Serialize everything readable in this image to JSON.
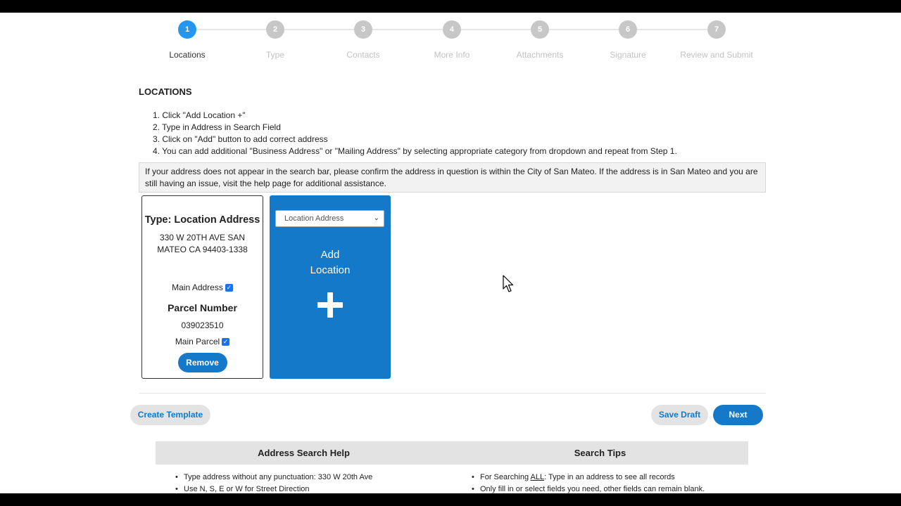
{
  "stepper": {
    "steps": [
      {
        "num": "1",
        "label": "Locations",
        "active": true
      },
      {
        "num": "2",
        "label": "Type"
      },
      {
        "num": "3",
        "label": "Contacts"
      },
      {
        "num": "4",
        "label": "More Info"
      },
      {
        "num": "5",
        "label": "Attachments"
      },
      {
        "num": "6",
        "label": "Signature"
      },
      {
        "num": "7",
        "label": "Review and Submit"
      }
    ]
  },
  "section": {
    "title": "LOCATIONS",
    "instructions": [
      "1. Click \"Add Location +\"",
      "2. Type in Address in Search Field",
      "3. Click on \"Add\" button to add correct address",
      "4. You can add additional \"Business Address\" or \"Mailing Address\" by selecting appropriate category from dropdown and repeat from Step 1."
    ],
    "notice": "If your address does not appear in the search bar, please confirm the address in question is within the City of San Mateo. If the address is in San Mateo and you are still having an issue, visit the help page for additional assistance."
  },
  "location_card": {
    "type_label": "Type: Location Address",
    "address": "330 W 20TH AVE SAN MATEO CA 94403-1338",
    "main_address_label": "Main Address",
    "parcel_title": "Parcel Number",
    "parcel_number": "039023510",
    "main_parcel_label": "Main Parcel",
    "remove_label": "Remove",
    "checkmark": "✓"
  },
  "add_card": {
    "select_value": "Location Address",
    "chevron": "⌄",
    "label_line1": "Add",
    "label_line2": "Location"
  },
  "actions": {
    "create_template": "Create Template",
    "save_draft": "Save Draft",
    "next": "Next"
  },
  "help": {
    "address_title": "Address Search Help",
    "address_tips": [
      "Type address without any punctuation: 330 W 20th Ave",
      "Use N, S, E or W  for Street Direction"
    ],
    "search_title": "Search Tips",
    "search_tip1_pre": "For Searching ",
    "search_tip1_u": "ALL",
    "search_tip1_post": ": Type in an address to see all records",
    "search_tip2": "Only fill in or select fields you need, other fields can remain blank."
  },
  "colors": {
    "primary": "#1479c8",
    "active_step": "#2196f3",
    "inactive_step": "#c7c7c7"
  }
}
